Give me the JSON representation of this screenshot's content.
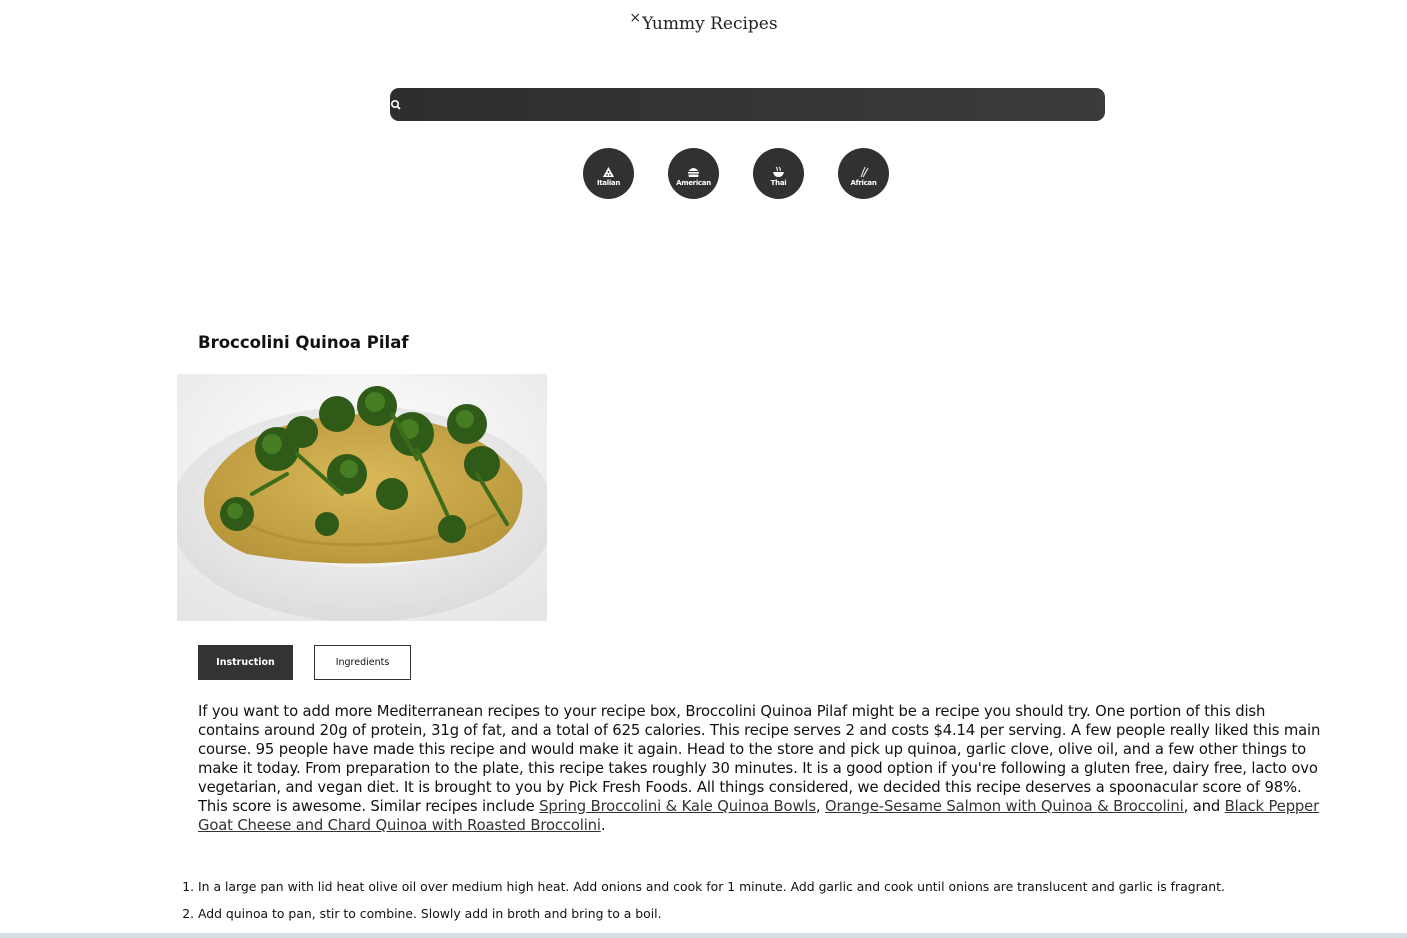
{
  "header": {
    "close_glyph": "×",
    "site_title": "Yummy Recipes"
  },
  "search": {
    "value": "",
    "placeholder": ""
  },
  "categories": [
    {
      "label": "Italian",
      "icon": "pizza-icon"
    },
    {
      "label": "American",
      "icon": "burger-icon"
    },
    {
      "label": "Thai",
      "icon": "bowl-icon"
    },
    {
      "label": "African",
      "icon": "utensils-icon"
    }
  ],
  "recipe": {
    "title": "Broccolini Quinoa Pilaf",
    "tabs": {
      "instruction": "Instruction",
      "ingredients": "Ingredients"
    },
    "summary": {
      "intro": "If you want to add more Mediterranean recipes to your recipe box, Broccolini Quinoa Pilaf might be a recipe you should try. One portion of this dish contains around 20g of protein, 31g of fat, and a total of 625 calories. This recipe serves 2 and costs $4.14 per serving. A few people really liked this main course. 95 people have made this recipe and would make it again. Head to the store and pick up quinoa, garlic clove, olive oil, and a few other things to make it today. From preparation to the plate, this recipe takes roughly 30 minutes. It is a good option if you're following a gluten free, dairy free, lacto ovo vegetarian, and vegan diet. It is brought to you by Pick Fresh Foods. All things considered, we decided this recipe deserves a spoonacular score of 98%. This score is awesome. Similar recipes include ",
      "link1": "Spring Broccolini & Kale Quinoa Bowls",
      "sep1": ", ",
      "link2": "Orange-Sesame Salmon with Quinoa & Broccolini",
      "sep2": ", and ",
      "link3": "Black Pepper Goat Cheese and Chard Quinoa with Roasted Broccolini",
      "end": "."
    },
    "steps": [
      "In a large pan with lid heat olive oil over medium high heat. Add onions and cook for 1 minute. Add garlic and cook until onions are translucent and garlic is fragrant.",
      "Add quinoa to pan, stir to combine. Slowly add in broth and bring to a boil."
    ]
  },
  "colors": {
    "dark": "#313131",
    "accent_link": "#333333",
    "bottom_bar": "#d5dee0"
  }
}
